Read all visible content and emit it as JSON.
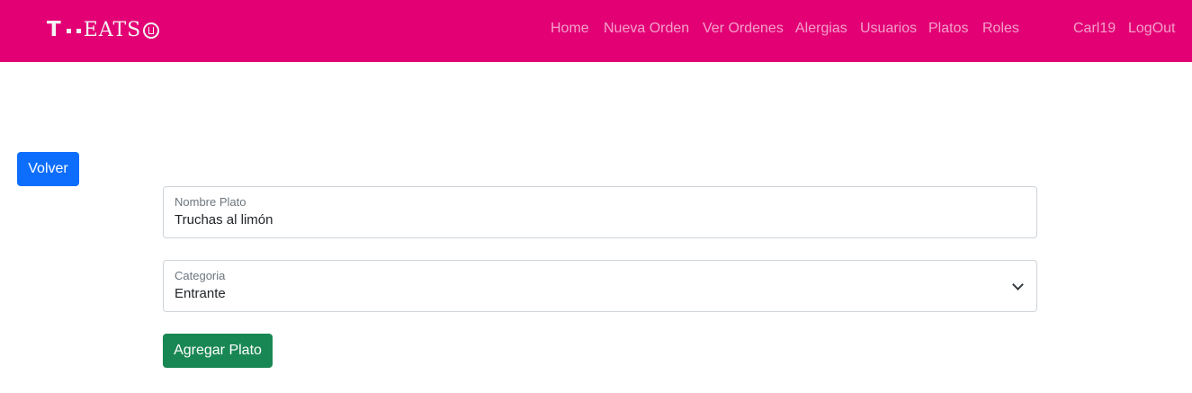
{
  "brand": {
    "t": "T",
    "name": "EATS"
  },
  "nav": {
    "items": [
      "Home",
      "Nueva Orden",
      "Ver Ordenes",
      "Alergias",
      "Usuarios",
      "Platos",
      "Roles"
    ],
    "user": "Carl19",
    "logout": "LogOut"
  },
  "page": {
    "back_label": "Volver",
    "nombre": {
      "label": "Nombre Plato",
      "value": "Truchas al limón"
    },
    "categoria": {
      "label": "Categoria",
      "value": "Entrante",
      "icon": "chevron-down-icon"
    },
    "submit_label": "Agregar Plato"
  },
  "colors": {
    "navbar": "#e20074",
    "primary": "#0d6efd",
    "success": "#198754"
  }
}
